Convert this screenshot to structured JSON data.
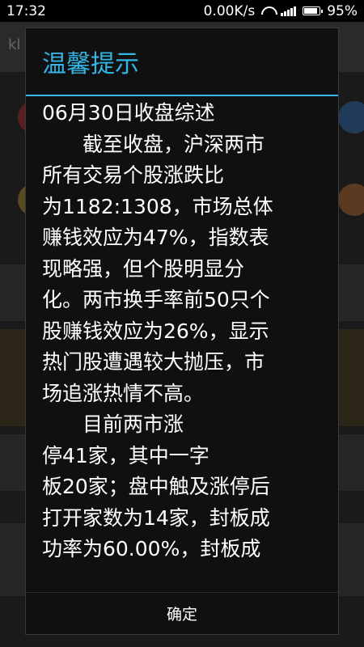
{
  "status_bar": {
    "time": "17:32",
    "network_speed": "0.00K/s",
    "battery_percent": "95%",
    "battery_level": 0.95,
    "icons": [
      "wifi-icon",
      "signal-icon",
      "battery-icon"
    ]
  },
  "background": {
    "title_fragment": "kl"
  },
  "dialog": {
    "title": "温馨提示",
    "accent_color": "#33b5e5",
    "lines": [
      "06月30日收盘综述",
      "　　截至收盘，沪深两市",
      "所有交易个股涨跌比",
      "为1182:1308，市场总体",
      "赚钱效应为47%，指数表",
      "现略强，但个股明显分",
      "化。两市换手率前50只个",
      "股赚钱效应为26%，显示",
      "热门股遭遇较大抛压，市",
      "场追涨热情不高。",
      "　　目前两市涨",
      "停41家，其中一字",
      "板20家；盘中触及涨停后",
      "打开家数为14家，封板成",
      "功率为60.00%，封板成"
    ],
    "confirm_label": "确定"
  }
}
